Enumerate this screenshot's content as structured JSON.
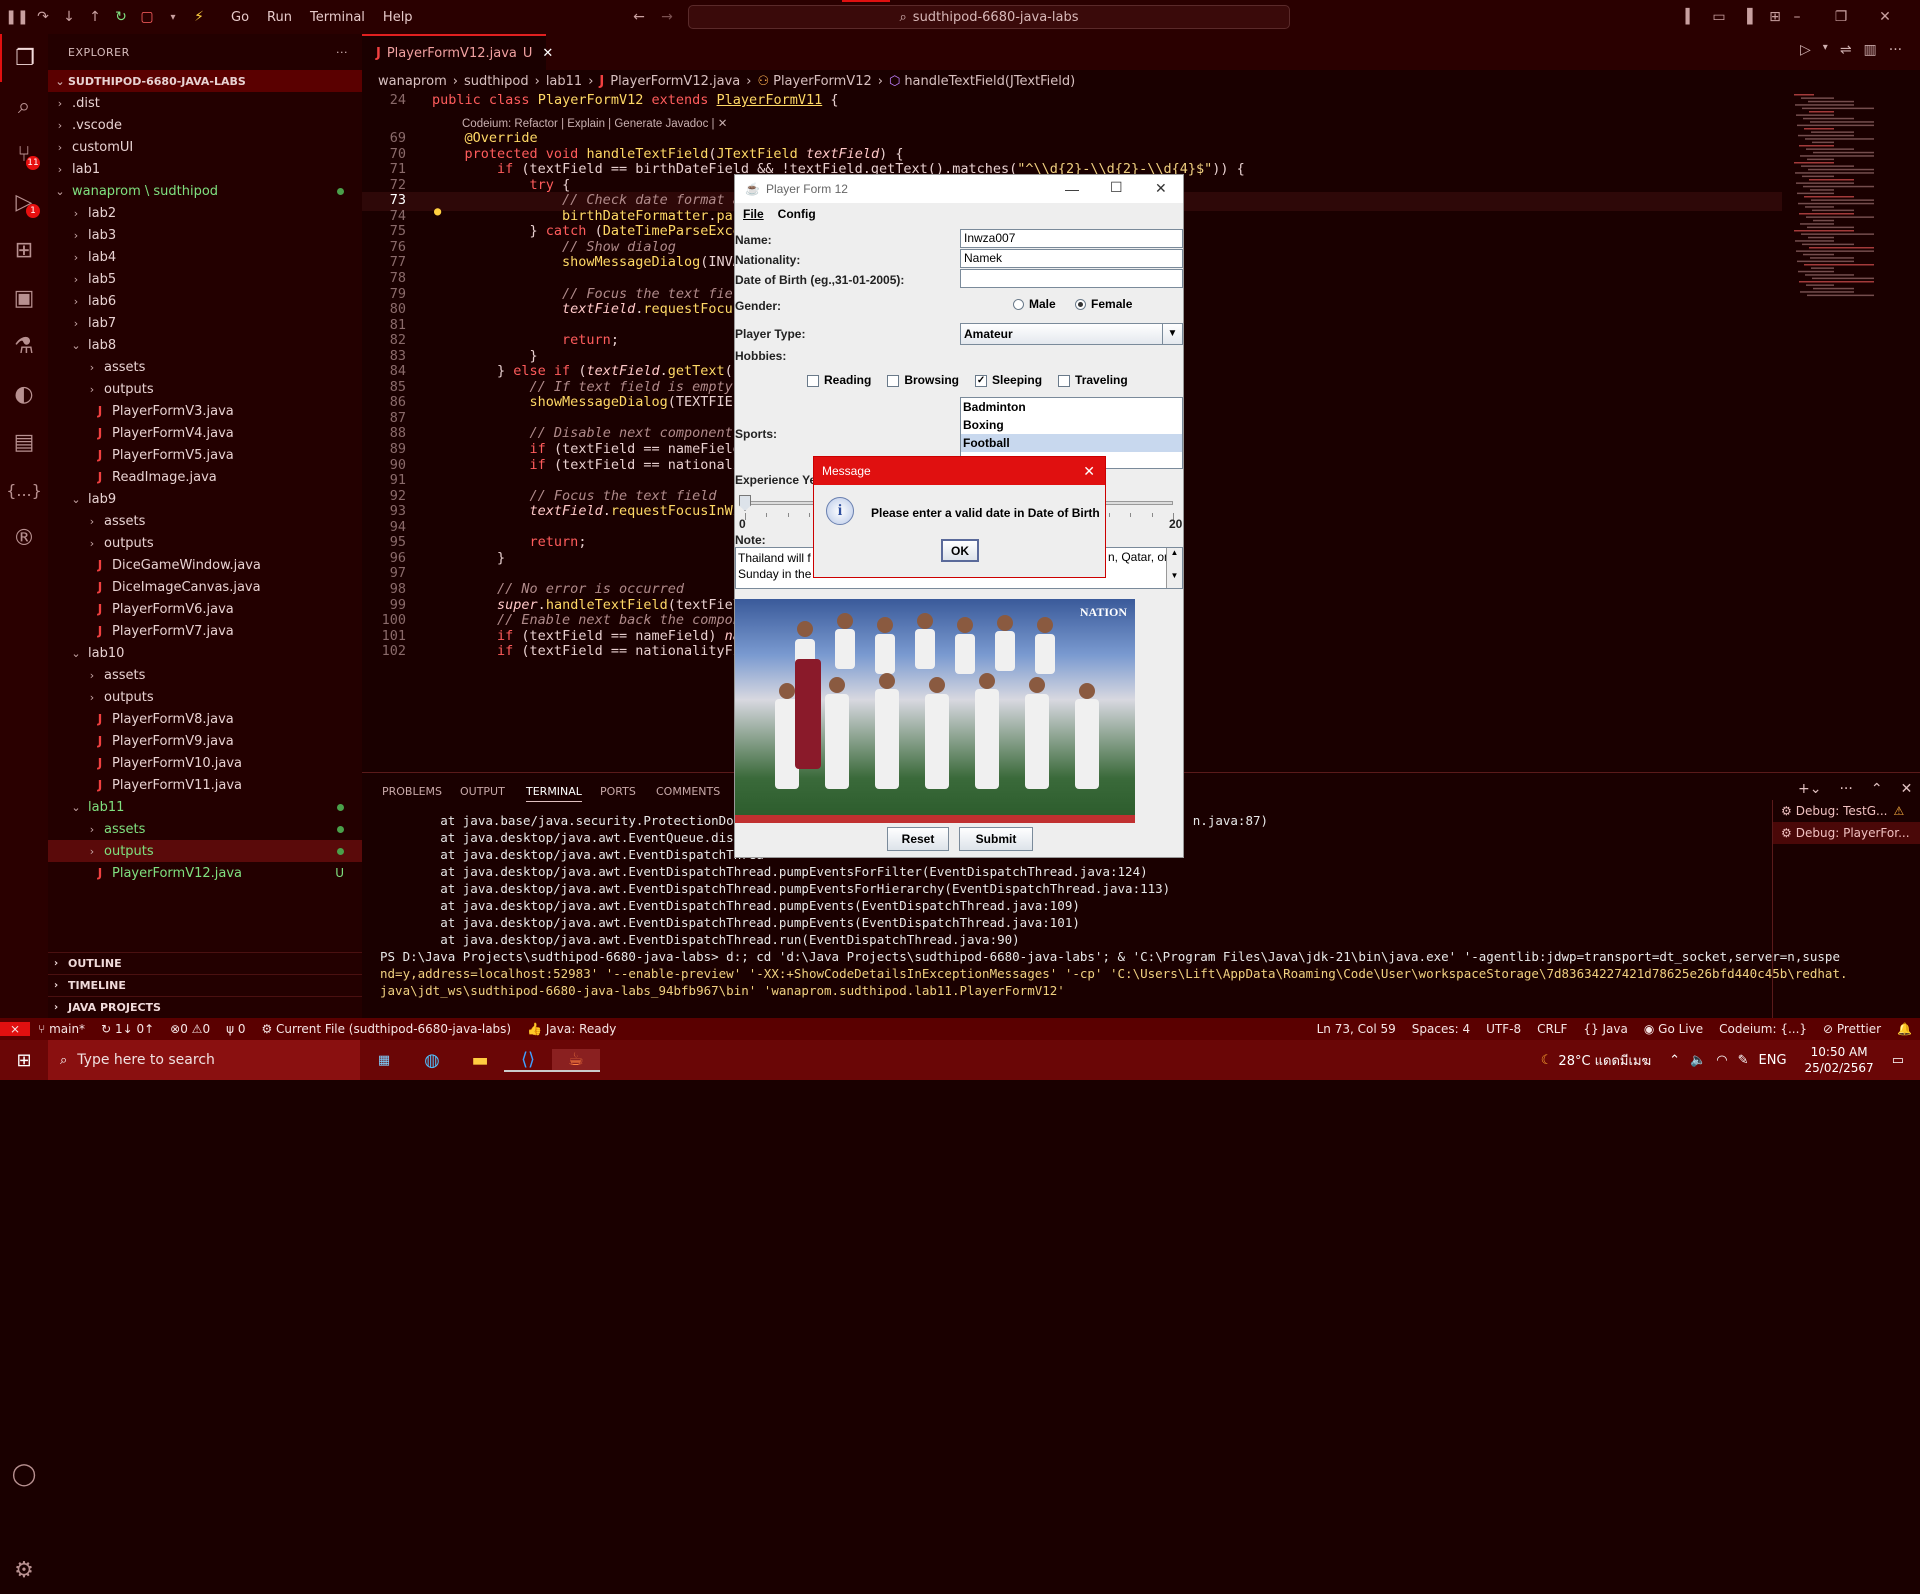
{
  "titlebar": {
    "menus": [
      "Go",
      "Run",
      "Terminal",
      "Help"
    ],
    "search": "sudthipod-6680-java-labs"
  },
  "activity": {
    "scm_badge": "11",
    "debug_badge": "1"
  },
  "sidebar": {
    "title": "EXPLORER",
    "more": "···",
    "root": "SUDTHIPOD-6680-JAVA-LABS",
    "items": [
      {
        "label": ".dist",
        "kind": "folder",
        "depth": 1,
        "open": false
      },
      {
        "label": ".vscode",
        "kind": "folder",
        "depth": 1,
        "open": false
      },
      {
        "label": "customUI",
        "kind": "folder",
        "depth": 1,
        "open": false
      },
      {
        "label": "lab1",
        "kind": "folder",
        "depth": 1,
        "open": false
      },
      {
        "label": "wanaprom \\ sudthipod",
        "kind": "folder",
        "depth": 1,
        "open": true,
        "green": true,
        "dot": true
      },
      {
        "label": "lab2",
        "kind": "folder",
        "depth": 2,
        "open": false
      },
      {
        "label": "lab3",
        "kind": "folder",
        "depth": 2,
        "open": false
      },
      {
        "label": "lab4",
        "kind": "folder",
        "depth": 2,
        "open": false
      },
      {
        "label": "lab5",
        "kind": "folder",
        "depth": 2,
        "open": false
      },
      {
        "label": "lab6",
        "kind": "folder",
        "depth": 2,
        "open": false
      },
      {
        "label": "lab7",
        "kind": "folder",
        "depth": 2,
        "open": false
      },
      {
        "label": "lab8",
        "kind": "folder",
        "depth": 2,
        "open": true
      },
      {
        "label": "assets",
        "kind": "folder",
        "depth": 3,
        "open": false
      },
      {
        "label": "outputs",
        "kind": "folder",
        "depth": 3,
        "open": false
      },
      {
        "label": "PlayerFormV3.java",
        "kind": "java",
        "depth": 3
      },
      {
        "label": "PlayerFormV4.java",
        "kind": "java",
        "depth": 3
      },
      {
        "label": "PlayerFormV5.java",
        "kind": "java",
        "depth": 3
      },
      {
        "label": "ReadImage.java",
        "kind": "java",
        "depth": 3
      },
      {
        "label": "lab9",
        "kind": "folder",
        "depth": 2,
        "open": true
      },
      {
        "label": "assets",
        "kind": "folder",
        "depth": 3,
        "open": false
      },
      {
        "label": "outputs",
        "kind": "folder",
        "depth": 3,
        "open": false
      },
      {
        "label": "DiceGameWindow.java",
        "kind": "java",
        "depth": 3
      },
      {
        "label": "DiceImageCanvas.java",
        "kind": "java",
        "depth": 3
      },
      {
        "label": "PlayerFormV6.java",
        "kind": "java",
        "depth": 3
      },
      {
        "label": "PlayerFormV7.java",
        "kind": "java",
        "depth": 3
      },
      {
        "label": "lab10",
        "kind": "folder",
        "depth": 2,
        "open": true
      },
      {
        "label": "assets",
        "kind": "folder",
        "depth": 3,
        "open": false
      },
      {
        "label": "outputs",
        "kind": "folder",
        "depth": 3,
        "open": false
      },
      {
        "label": "PlayerFormV8.java",
        "kind": "java",
        "depth": 3
      },
      {
        "label": "PlayerFormV9.java",
        "kind": "java",
        "depth": 3
      },
      {
        "label": "PlayerFormV10.java",
        "kind": "java",
        "depth": 3
      },
      {
        "label": "PlayerFormV11.java",
        "kind": "java",
        "depth": 3
      },
      {
        "label": "lab11",
        "kind": "folder",
        "depth": 2,
        "open": true,
        "green": true,
        "dot": true
      },
      {
        "label": "assets",
        "kind": "folder",
        "depth": 3,
        "open": false,
        "green": true,
        "dot": true
      },
      {
        "label": "outputs",
        "kind": "folder",
        "depth": 3,
        "open": false,
        "green": true,
        "dot": true,
        "selected": true
      },
      {
        "label": "PlayerFormV12.java",
        "kind": "java",
        "depth": 3,
        "green": true,
        "badge": "U"
      }
    ],
    "sections": [
      "OUTLINE",
      "TIMELINE",
      "JAVA PROJECTS"
    ]
  },
  "editor": {
    "tab_label": "PlayerFormV12.java",
    "tab_badge": "U",
    "breadcrumbs": [
      "wanaprom",
      "sudthipod",
      "lab11",
      "PlayerFormV12.java",
      "PlayerFormV12",
      "handleTextField(JTextField)"
    ],
    "codelens": "Codeium: Refactor | Explain | Generate Javadoc | ✕",
    "lines": [
      {
        "n": "24",
        "html": "<span class='kw'>public class</span> <span class='ty'>PlayerFormV12</span> <span class='kw'>extends</span> <span class='ty' style='text-decoration:underline'>PlayerFormV11</span> {"
      },
      {
        "n": "",
        "html": ""
      },
      {
        "n": "69",
        "html": "    <span class='ty'>@Override</span>"
      },
      {
        "n": "70",
        "html": "    <span class='kw'>protected void</span> <span class='fn'>handleTextField</span>(<span class='ty'>JTextField</span> <span class='va'>textField</span>) {"
      },
      {
        "n": "71",
        "html": "        <span class='kw'>if</span> (textField == birthDateField &amp;&amp; !textField.getText().matches(<span class='tstr'>\"^\\\\d{2}-\\\\d{2}-\\\\d{4}$\"</span>)) {"
      },
      {
        "n": "72",
        "html": "            <span class='kw'>try</span> {"
      },
      {
        "n": "73",
        "html": "                <span class='cm'>// Check date format as</span>"
      },
      {
        "n": "74",
        "html": "                <span class='fn'>birthDateFormatter</span>.<span class='fn'>parse</span>"
      },
      {
        "n": "75",
        "html": "            } <span class='kw'>catch</span> (<span class='ty'>DateTimeParseExcept</span>"
      },
      {
        "n": "76",
        "html": "                <span class='cm'>// Show dialog</span>"
      },
      {
        "n": "77",
        "html": "                <span class='fn'>showMessageDialog</span>(INVAL"
      },
      {
        "n": "78",
        "html": ""
      },
      {
        "n": "79",
        "html": "                <span class='cm'>// Focus the text field</span>"
      },
      {
        "n": "80",
        "html": "                <span class='va'>textField</span>.<span class='fn'>requestFocusIn</span>"
      },
      {
        "n": "81",
        "html": ""
      },
      {
        "n": "82",
        "html": "                <span class='kw'>return</span>;"
      },
      {
        "n": "83",
        "html": "            }"
      },
      {
        "n": "84",
        "html": "        } <span class='kw'>else if</span> (<span class='va'>textField</span>.<span class='fn'>getText</span>().i"
      },
      {
        "n": "85",
        "html": "            <span class='cm'>// If text field is empty, s</span>"
      },
      {
        "n": "86",
        "html": "            <span class='fn'>showMessageDialog</span>(TEXTFIELD_"
      },
      {
        "n": "87",
        "html": ""
      },
      {
        "n": "88",
        "html": "            <span class='cm'>// Disable next component</span>"
      },
      {
        "n": "89",
        "html": "            <span class='kw'>if</span> (textField == nameField)"
      },
      {
        "n": "90",
        "html": "            <span class='kw'>if</span> (textField == nationality"
      },
      {
        "n": "91",
        "html": ""
      },
      {
        "n": "92",
        "html": "            <span class='cm'>// Focus the text field</span>"
      },
      {
        "n": "93",
        "html": "            <span class='va'>textField</span>.<span class='fn'>requestFocusInWind</span>"
      },
      {
        "n": "94",
        "html": ""
      },
      {
        "n": "95",
        "html": "            <span class='kw'>return</span>;"
      },
      {
        "n": "96",
        "html": "        }"
      },
      {
        "n": "97",
        "html": ""
      },
      {
        "n": "98",
        "html": "        <span class='cm'>// No error is occurred</span>"
      },
      {
        "n": "99",
        "html": "        <span class='va'>super</span>.<span class='fn'>handleTextField</span>(textField)"
      },
      {
        "n": "100",
        "html": "        <span class='cm'>// Enable next back the componer</span>"
      },
      {
        "n": "101",
        "html": "        <span class='kw'>if</span> (textField == nameField) <span class='va'>nati</span>"
      },
      {
        "n": "102",
        "html": "        <span class='kw'>if</span> (textField == nationalityFiel"
      }
    ]
  },
  "panel": {
    "tabs": [
      "PROBLEMS",
      "OUTPUT",
      "TERMINAL",
      "PORTS",
      "COMMENTS"
    ],
    "active_tab": "TERMINAL",
    "lines": [
      "        at java.base/java.security.ProtectionDomai                                                          n.java:87)",
      "        at java.desktop/java.awt.EventQueue.dispatc",
      "        at java.desktop/java.awt.EventDispatchThrea",
      "        at java.desktop/java.awt.EventDispatchThread.pumpEventsForFilter(EventDispatchThread.java:124)",
      "        at java.desktop/java.awt.EventDispatchThread.pumpEventsForHierarchy(EventDispatchThread.java:113)",
      "        at java.desktop/java.awt.EventDispatchThread.pumpEvents(EventDispatchThread.java:109)",
      "        at java.desktop/java.awt.EventDispatchThread.pumpEvents(EventDispatchThread.java:101)",
      "        at java.desktop/java.awt.EventDispatchThread.run(EventDispatchThread.java:90)"
    ],
    "cmd1": "PS D:\\Java Projects\\sudthipod-6680-java-labs> d:; cd 'd:\\Java Projects\\sudthipod-6680-java-labs'; & 'C:\\Program Files\\Java\\jdk-21\\bin\\java.exe' '-agentlib:jdwp=transport=dt_socket,server=n,suspe",
    "cmd2": "nd=y,address=localhost:52983' '--enable-preview' '-XX:+ShowCodeDetailsInExceptionMessages' '-cp' 'C:\\Users\\Lift\\AppData\\Roaming\\Code\\User\\workspaceStorage\\7d83634227421d78625e26bfd440c45b\\redhat.",
    "cmd3": "java\\jdt_ws\\sudthipod-6680-java-labs_94bfb967\\bin' 'wanaprom.sudthipod.lab11.PlayerFormV12'",
    "debug1": "Debug: TestG...",
    "debug2": "Debug: PlayerFor..."
  },
  "status": {
    "branch": "main*",
    "sync": "1↓ 0↑",
    "errors": "0",
    "warnings": "0",
    "ports": "0",
    "launch": "Current File (sudthipod-6680-java-labs)",
    "java": "Java: Ready",
    "position": "Ln 73, Col 59",
    "spaces": "Spaces: 4",
    "encoding": "UTF-8",
    "eol": "CRLF",
    "lang": "Java",
    "golive": "Go Live",
    "codeium": "Codeium: {...}",
    "prettier": "Prettier"
  },
  "taskbar": {
    "search_placeholder": "Type here to search",
    "weather": "28°C แดดมีเมฆ",
    "lang": "ENG",
    "time": "10:50 AM",
    "date": "25/02/2567"
  },
  "swing": {
    "title": "Player Form 12",
    "menus": [
      "File",
      "Config"
    ],
    "name_label": "Name:",
    "name_value": "Inwza007",
    "nationality_label": "Nationality:",
    "nationality_value": "Namek",
    "dob_label": "Date of Birth (eg.,31-01-2005):",
    "dob_value": "",
    "gender_label": "Gender:",
    "gender_options": [
      "Male",
      "Female"
    ],
    "gender_selected": "Female",
    "type_label": "Player Type:",
    "type_value": "Amateur",
    "hobbies_label": "Hobbies:",
    "hobbies": [
      {
        "label": "Reading",
        "checked": false
      },
      {
        "label": "Browsing",
        "checked": false
      },
      {
        "label": "Sleeping",
        "checked": true
      },
      {
        "label": "Traveling",
        "checked": false
      }
    ],
    "sports_label": "Sports:",
    "sports": [
      "Badminton",
      "Boxing",
      "Football"
    ],
    "sports_selected": "Football",
    "exp_label": "Experience Ye",
    "slider_min": "0",
    "slider_max": "20",
    "slider_value": 0,
    "note_label": "Note:",
    "note_left": "Thailand will f\nSunday in the",
    "note_right": "n, Qatar, on",
    "image_watermark": "NATION",
    "reset": "Reset",
    "submit": "Submit"
  },
  "dialog": {
    "title": "Message",
    "message": "Please enter a valid date in Date of Birth",
    "ok": "OK"
  },
  "colors": {
    "accent": "#e01010",
    "background": "#1a0000",
    "green": "#7fe07f"
  }
}
